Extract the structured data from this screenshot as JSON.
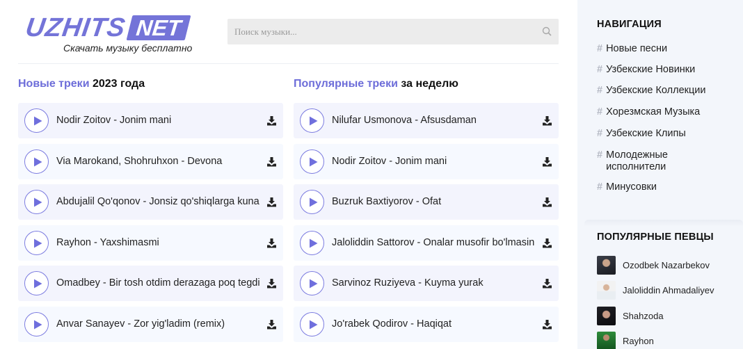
{
  "logo": {
    "word": "UZHITS",
    "badge": "NET",
    "tagline": "Скачать музыку бесплатно"
  },
  "search": {
    "placeholder": "Поиск музыки..."
  },
  "new_tracks": {
    "title_accent": "Новые треки",
    "title_rest": "2023 года",
    "tracks": [
      "Nodir Zoitov - Jonim mani",
      "Via Marokand, Shohruhxon - Devona",
      "Abdujalil Qo'qonov - Jonsiz qo'shiqlarga kuna",
      "Rayhon - Yaxshimasmi",
      "Omadbey - Bir tosh otdim derazaga poq tegdi",
      "Anvar Sanayev - Zor yig'ladim (remix)"
    ]
  },
  "popular_tracks": {
    "title_accent": "Популярные треки",
    "title_rest": "за неделю",
    "tracks": [
      "Nilufar Usmonova - Afsusdaman",
      "Nodir Zoitov - Jonim mani",
      "Buzruk Baxtiyorov - Ofat",
      "Jaloliddin Sattorov - Onalar musofir bo'lmasin",
      "Sarvinoz Ruziyeva - Kuyma yurak",
      "Jo'rabek Qodirov - Haqiqat"
    ]
  },
  "sidebar": {
    "nav_title": "НАВИГАЦИЯ",
    "nav_items": [
      "Новые песни",
      "Узбекские Новинки",
      "Узбекские Коллекции",
      "Хорезмская Музыка",
      "Узбекские Клипы",
      "Молодежные исполнители",
      "Минусовки"
    ],
    "singers_title": "ПОПУЛЯРНЫЕ ПЕВЦЫ",
    "singers": [
      "Ozodbek Nazarbekov",
      "Jaloliddin Ahmadaliyev",
      "Shahzoda",
      "Rayhon"
    ]
  },
  "colors": {
    "accent": "#6d6dd9",
    "sidebar_bg": "#f3f6fb",
    "track_bg": "#f3f4fd"
  },
  "icons": {
    "play": "play-icon",
    "download": "download-icon",
    "search": "search-icon",
    "hash": "hash-icon"
  }
}
